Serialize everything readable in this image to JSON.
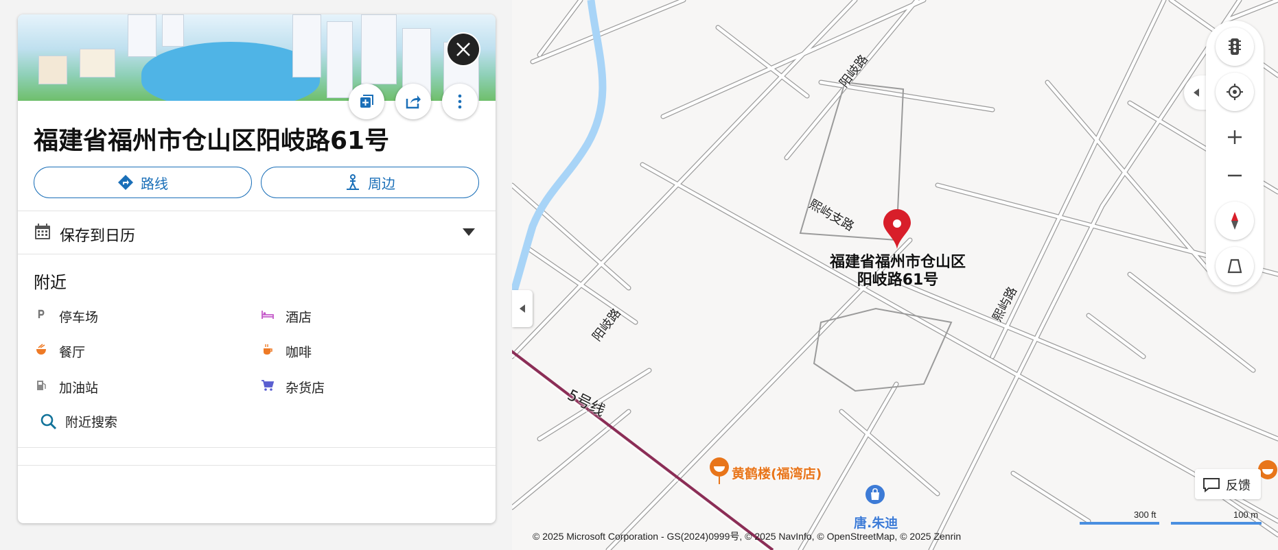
{
  "panel": {
    "title": "福建省福州市仓山区阳岐路61号",
    "buttons": {
      "directions": "路线",
      "nearby": "周边"
    },
    "calendar": {
      "label": "保存到日历"
    },
    "nearby_section": {
      "title": "附近",
      "items": [
        {
          "label": "停车场",
          "icon": "parking-icon"
        },
        {
          "label": "酒店",
          "icon": "bed-icon"
        },
        {
          "label": "餐厅",
          "icon": "restaurant-icon"
        },
        {
          "label": "咖啡",
          "icon": "coffee-icon"
        },
        {
          "label": "加油站",
          "icon": "gas-station-icon"
        },
        {
          "label": "杂货店",
          "icon": "shopping-cart-icon"
        }
      ],
      "search_label": "附近搜索"
    }
  },
  "map": {
    "pin_label": "福建省福州市仓山区阳岐路61号",
    "road_labels": [
      "阳岐路",
      "熙屿支路",
      "阳岐路",
      "熙屿路",
      "5号线"
    ],
    "pois": [
      {
        "label": "黄鹤楼(福湾店)",
        "color": "#e8751a",
        "icon": "restaurant-icon"
      },
      {
        "label": "唐.朱迪",
        "color": "#3d7bd6",
        "icon": "shopping-bag-icon"
      }
    ],
    "feedback_label": "反馈",
    "copyright": "© 2025 Microsoft Corporation - GS(2024)0999号, © 2025 NavInfo,   © OpenStreetMap, © 2025 Zenrin",
    "scale": {
      "imperial": "300 ft",
      "metric": "100 m"
    },
    "colors": {
      "river": "#a8d4f7",
      "metro_line": "#8b2d56",
      "pin": "#d81e2a",
      "road": "#9a9a9a"
    }
  }
}
